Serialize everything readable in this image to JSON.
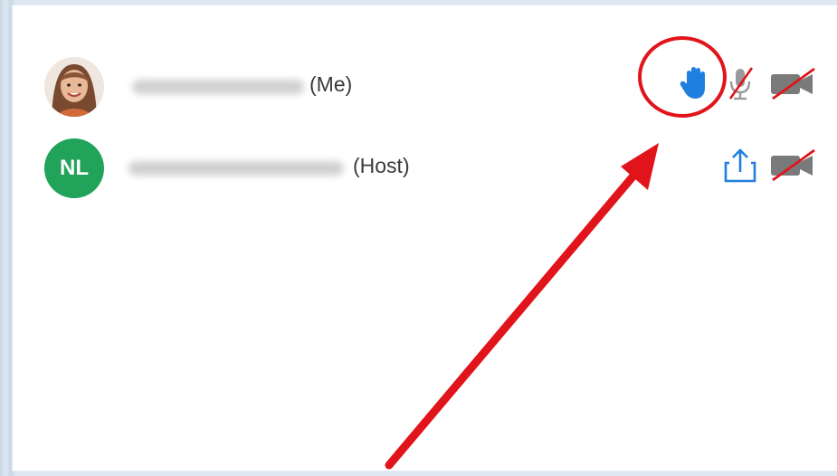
{
  "participants": [
    {
      "suffix": "(Me)",
      "avatar": "photo",
      "icons": [
        "hand-raised-icon",
        "mic-muted-icon",
        "video-off-icon"
      ]
    },
    {
      "initials": "NL",
      "suffix": "(Host)",
      "avatar_color": "#22a35a",
      "icons": [
        "share-screen-icon",
        "video-off-icon"
      ]
    }
  ],
  "colors": {
    "hand_icon": "#1f7fe0",
    "muted_strike": "#e0141a",
    "annotation": "#e0141a",
    "host_avatar": "#22a35a"
  }
}
